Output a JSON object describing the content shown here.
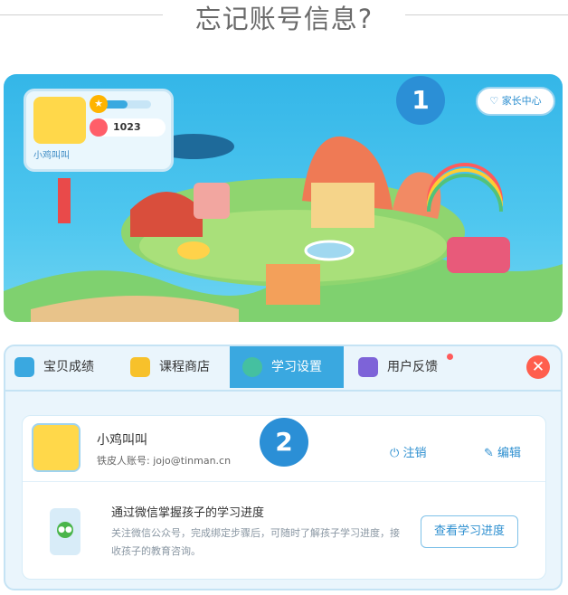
{
  "page_title": "忘记账号信息?",
  "map": {
    "profile": {
      "name": "小鸡叫叫",
      "level_progress": 0.6,
      "level_icon": "star-level-icon",
      "coin_icon": "lollipop-coin-icon",
      "coins": "1023"
    },
    "parent_center_label": "家长中心",
    "parent_center_icon": "heart-icon",
    "markers": [
      "1",
      "2"
    ]
  },
  "settings": {
    "tabs": [
      {
        "label": "宝贝成绩",
        "icon": "report-icon",
        "icon_color": "#3aa8e0"
      },
      {
        "label": "课程商店",
        "icon": "shopping-bag-icon",
        "icon_color": "#f7c12b"
      },
      {
        "label": "学习设置",
        "icon": "gear-icon",
        "icon_color": "#45c0a0"
      },
      {
        "label": "用户反馈",
        "icon": "feedback-icon",
        "icon_color": "#7d63d8"
      }
    ],
    "active_tab": 2,
    "user": {
      "name": "小鸡叫叫",
      "account_label": "铁皮人账号: jojo@tinman.cn",
      "logout_label": "注销",
      "edit_label": "编辑"
    },
    "wechat": {
      "title": "通过微信掌握孩子的学习进度",
      "desc": "关注微信公众号，完成绑定步骤后，可随时了解孩子学习进度，接收孩子的教育咨询。",
      "button_label": "查看学习进度"
    }
  },
  "colors": {
    "accent": "#3aa8e0",
    "close": "#ff5e4d",
    "marker": "#2b8fd6"
  }
}
